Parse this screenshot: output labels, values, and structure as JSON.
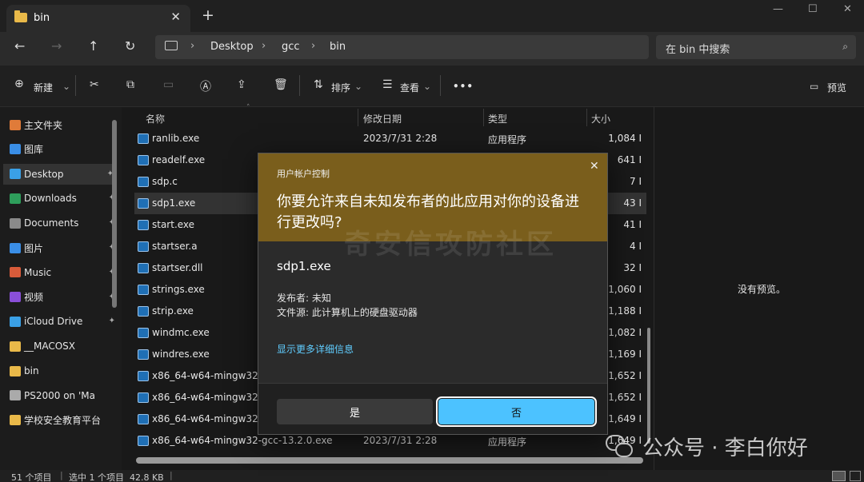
{
  "window": {
    "tab_title": "bin",
    "tab_close": "✕",
    "new_tab": "+",
    "minimize": "—",
    "maximize": "☐",
    "close": "✕"
  },
  "nav": {
    "back": "←",
    "forward": "→",
    "up": "↑",
    "refresh": "↻"
  },
  "breadcrumb": [
    "Desktop",
    "gcc",
    "bin"
  ],
  "search": {
    "placeholder": "在 bin 中搜索"
  },
  "toolbar": {
    "new_label": "新建",
    "sort_label": "排序",
    "view_label": "查看",
    "more": "•••",
    "preview_label": "预览"
  },
  "sidebar": {
    "items": [
      {
        "label": "主文件夹",
        "color": "#e07b39",
        "pinned": false
      },
      {
        "label": "图库",
        "color": "#3a8ee6",
        "pinned": false
      },
      {
        "label": "Desktop",
        "color": "#3aa0e6",
        "pinned": true,
        "selected": true
      },
      {
        "label": "Downloads",
        "color": "#2e9e5b",
        "pinned": true
      },
      {
        "label": "Documents",
        "color": "#8a8a8a",
        "pinned": true
      },
      {
        "label": "图片",
        "color": "#3a8ee6",
        "pinned": true
      },
      {
        "label": "Music",
        "color": "#d85b3a",
        "pinned": true
      },
      {
        "label": "视频",
        "color": "#8a4fd8",
        "pinned": true
      },
      {
        "label": "iCloud Drive",
        "color": "#3aa0e6",
        "pinned": true
      },
      {
        "label": "__MACOSX",
        "color": "#e9b949",
        "pinned": false
      },
      {
        "label": "bin",
        "color": "#e9b949",
        "pinned": false
      },
      {
        "label": "PS2000 on 'Ma",
        "color": "#aaaaaa",
        "pinned": false
      },
      {
        "label": "学校安全教育平台",
        "color": "#e9b949",
        "pinned": false
      }
    ],
    "pin_glyph": "📌"
  },
  "columns": {
    "name": "名称",
    "date": "修改日期",
    "type": "类型",
    "size": "大小"
  },
  "files": [
    {
      "name": "ranlib.exe",
      "date": "2023/7/31 2:28",
      "type": "应用程序",
      "size": "1,084 I"
    },
    {
      "name": "readelf.exe",
      "date": "",
      "type": "",
      "size": "641 I"
    },
    {
      "name": "sdp.c",
      "date": "",
      "type": "",
      "size": "7 I"
    },
    {
      "name": "sdp1.exe",
      "date": "",
      "type": "",
      "size": "43 I",
      "selected": true
    },
    {
      "name": "start.exe",
      "date": "",
      "type": "",
      "size": "41 I"
    },
    {
      "name": "startser.a",
      "date": "",
      "type": "",
      "size": "4 I"
    },
    {
      "name": "startser.dll",
      "date": "",
      "type": "",
      "size": "32 I"
    },
    {
      "name": "strings.exe",
      "date": "",
      "type": "",
      "size": "1,060 I"
    },
    {
      "name": "strip.exe",
      "date": "",
      "type": "",
      "size": "1,188 I"
    },
    {
      "name": "windmc.exe",
      "date": "",
      "type": "",
      "size": "1,082 I"
    },
    {
      "name": "windres.exe",
      "date": "",
      "type": "",
      "size": "1,169 I"
    },
    {
      "name": "x86_64-w64-mingw32-c",
      "date": "",
      "type": "",
      "size": "1,652 I"
    },
    {
      "name": "x86_64-w64-mingw32-g",
      "date": "",
      "type": "",
      "size": "1,652 I"
    },
    {
      "name": "x86_64-w64-mingw32-g",
      "date": "",
      "type": "",
      "size": "1,649 I"
    },
    {
      "name": "x86_64-w64-mingw32-gcc-13.2.0.exe",
      "date": "2023/7/31 2:28",
      "type": "应用程序",
      "size": "1,649 I"
    }
  ],
  "preview": {
    "empty_text": "没有预览。"
  },
  "status": {
    "count": "51 个项目",
    "selected": "选中 1 个项目  42.8 KB"
  },
  "uac": {
    "header": "用户帐户控制",
    "close": "✕",
    "question": "你要允许来自未知发布者的此应用对你的设备进行更改吗?",
    "app_name": "sdp1.exe",
    "publisher": "发布者: 未知",
    "origin": "文件源: 此计算机上的硬盘驱动器",
    "more_info": "显示更多详细信息",
    "yes": "是",
    "no": "否"
  },
  "watermark": "奇安信攻防社区",
  "wechat": "公众号 · 李白你好",
  "colors": {
    "accent": "#4cc2ff",
    "uac_header": "#7a5e1c",
    "folder": "#e9b949",
    "link": "#60cdff"
  }
}
